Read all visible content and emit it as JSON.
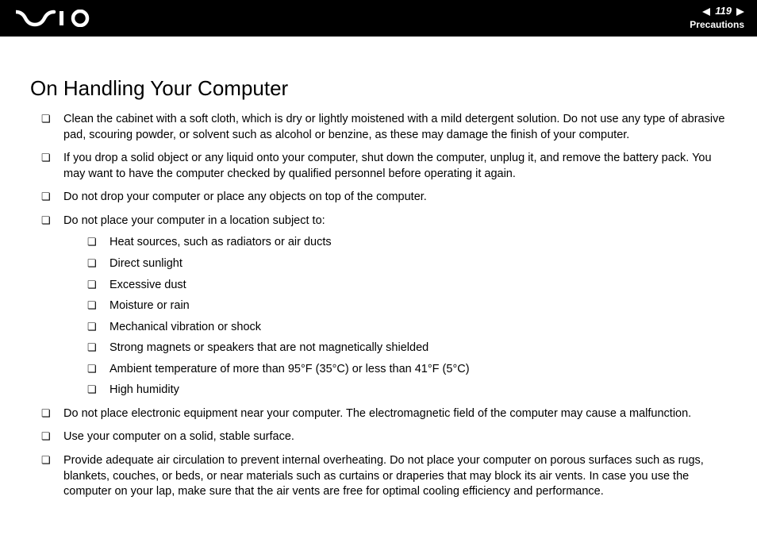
{
  "header": {
    "page_number": "119",
    "section": "Precautions"
  },
  "title": "On Handling Your Computer",
  "bullets": [
    "Clean the cabinet with a soft cloth, which is dry or lightly moistened with a mild detergent solution. Do not use any type of abrasive pad, scouring powder, or solvent such as alcohol or benzine, as these may damage the finish of your computer.",
    "If you drop a solid object or any liquid onto your computer, shut down the computer, unplug it, and remove the battery pack. You may want to have the computer checked by qualified personnel before operating it again.",
    "Do not drop your computer or place any objects on top of the computer.",
    "Do not place your computer in a location subject to:",
    "Do not place electronic equipment near your computer. The electromagnetic field of the computer may cause a malfunction.",
    "Use your computer on a solid, stable surface.",
    "Provide adequate air circulation to prevent internal overheating. Do not place your computer on porous surfaces such as rugs, blankets, couches, or beds, or near materials such as curtains or draperies that may block its air vents. In case you use the computer on your lap, make sure that the air vents are free for optimal cooling efficiency and performance."
  ],
  "nested_bullets": [
    "Heat sources, such as radiators or air ducts",
    "Direct sunlight",
    "Excessive dust",
    "Moisture or rain",
    "Mechanical vibration or shock",
    "Strong magnets or speakers that are not magnetically shielded",
    "Ambient temperature of more than 95°F (35°C) or less than 41°F (5°C)",
    "High humidity"
  ]
}
